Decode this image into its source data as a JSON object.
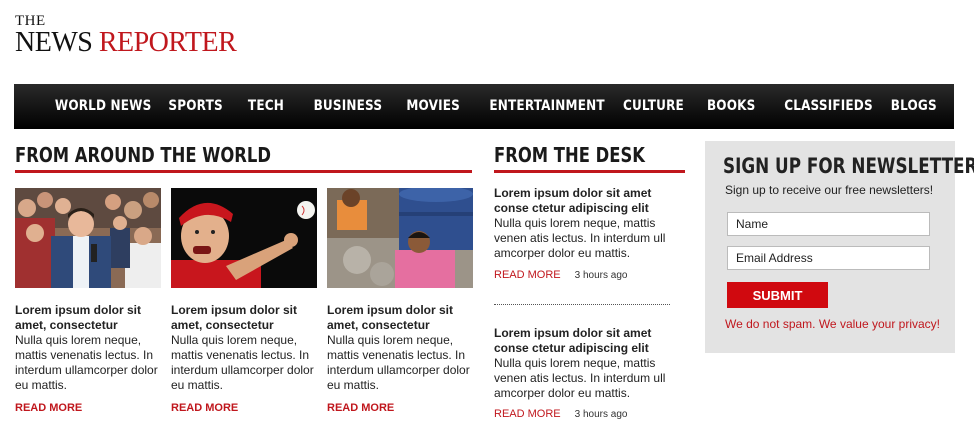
{
  "logo": {
    "the": "THE",
    "news": "NEWS",
    "reporter": "REPORTER"
  },
  "nav": [
    "WORLD NEWS",
    "SPORTS",
    "TECH",
    "BUSINESS",
    "MOVIES",
    "ENTERTAINMENT",
    "CULTURE",
    "BOOKS",
    "CLASSIFIEDS",
    "BLOGS"
  ],
  "world": {
    "title": "FROM AROUND THE WORLD",
    "stories": [
      {
        "headline": "Lorem ipsum dolor sit amet, consectetur",
        "body": "Nulla quis lorem neque, mattis venenatis lectus. In interdum ullamcorper dolor eu mattis.",
        "read_more": "READ MORE"
      },
      {
        "headline": "Lorem ipsum dolor sit amet, consectetur",
        "body": "Nulla quis lorem neque, mattis venenatis lectus. In interdum ullamcorper dolor eu mattis.",
        "read_more": "READ MORE"
      },
      {
        "headline": "Lorem ipsum dolor sit amet, consectetur",
        "body": "Nulla quis lorem neque, mattis venenatis lectus. In interdum ullamcorper dolor eu mattis.",
        "read_more": "READ MORE"
      }
    ]
  },
  "desk": {
    "title": "FROM THE DESK",
    "items": [
      {
        "headline": "Lorem ipsum dolor sit amet conse ctetur adipiscing elit",
        "body": "Nulla quis lorem neque, mattis venen atis lectus. In interdum ull amcorper dolor eu mattis.",
        "read_more": "READ MORE",
        "time": "3 hours ago"
      },
      {
        "headline": "Lorem ipsum dolor sit amet conse ctetur adipiscing elit",
        "body": "Nulla quis lorem neque, mattis venen atis lectus. In interdum ull amcorper dolor eu mattis.",
        "read_more": "READ MORE",
        "time": "3 hours ago"
      }
    ]
  },
  "newsletter": {
    "title": "SIGN UP FOR NEWSLETTER",
    "subtitle": "Sign up to receive our free newsletters!",
    "name_value": "Name",
    "email_value": "Email Address",
    "submit": "SUBMIT",
    "note": "We do not spam. We value your privacy!"
  },
  "colors": {
    "accent": "#c0171d",
    "nav_bg": "#000000",
    "panel_bg": "#e3e3e3"
  }
}
